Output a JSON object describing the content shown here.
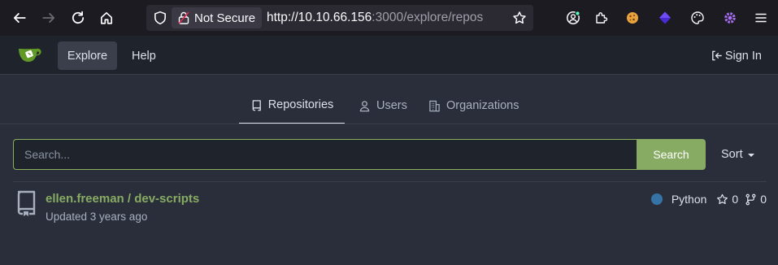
{
  "browser": {
    "security_label": "Not Secure",
    "url_host": "http://10.10.66.156",
    "url_path": ":3000/explore/repos"
  },
  "header": {
    "nav_explore": "Explore",
    "nav_help": "Help",
    "sign_in": "Sign In"
  },
  "tabs": [
    {
      "label": "Repositories",
      "active": true
    },
    {
      "label": "Users",
      "active": false
    },
    {
      "label": "Organizations",
      "active": false
    }
  ],
  "search": {
    "placeholder": "Search...",
    "button_label": "Search",
    "sort_label": "Sort"
  },
  "repos": [
    {
      "full_name": "ellen.freeman / dev-scripts",
      "updated": "Updated 3 years ago",
      "language": "Python",
      "language_color": "#3572a5",
      "stars": "0",
      "forks": "0"
    }
  ],
  "colors": {
    "accent": "#87ab63",
    "background": "#2a2e3a",
    "header": "#1f232c"
  }
}
